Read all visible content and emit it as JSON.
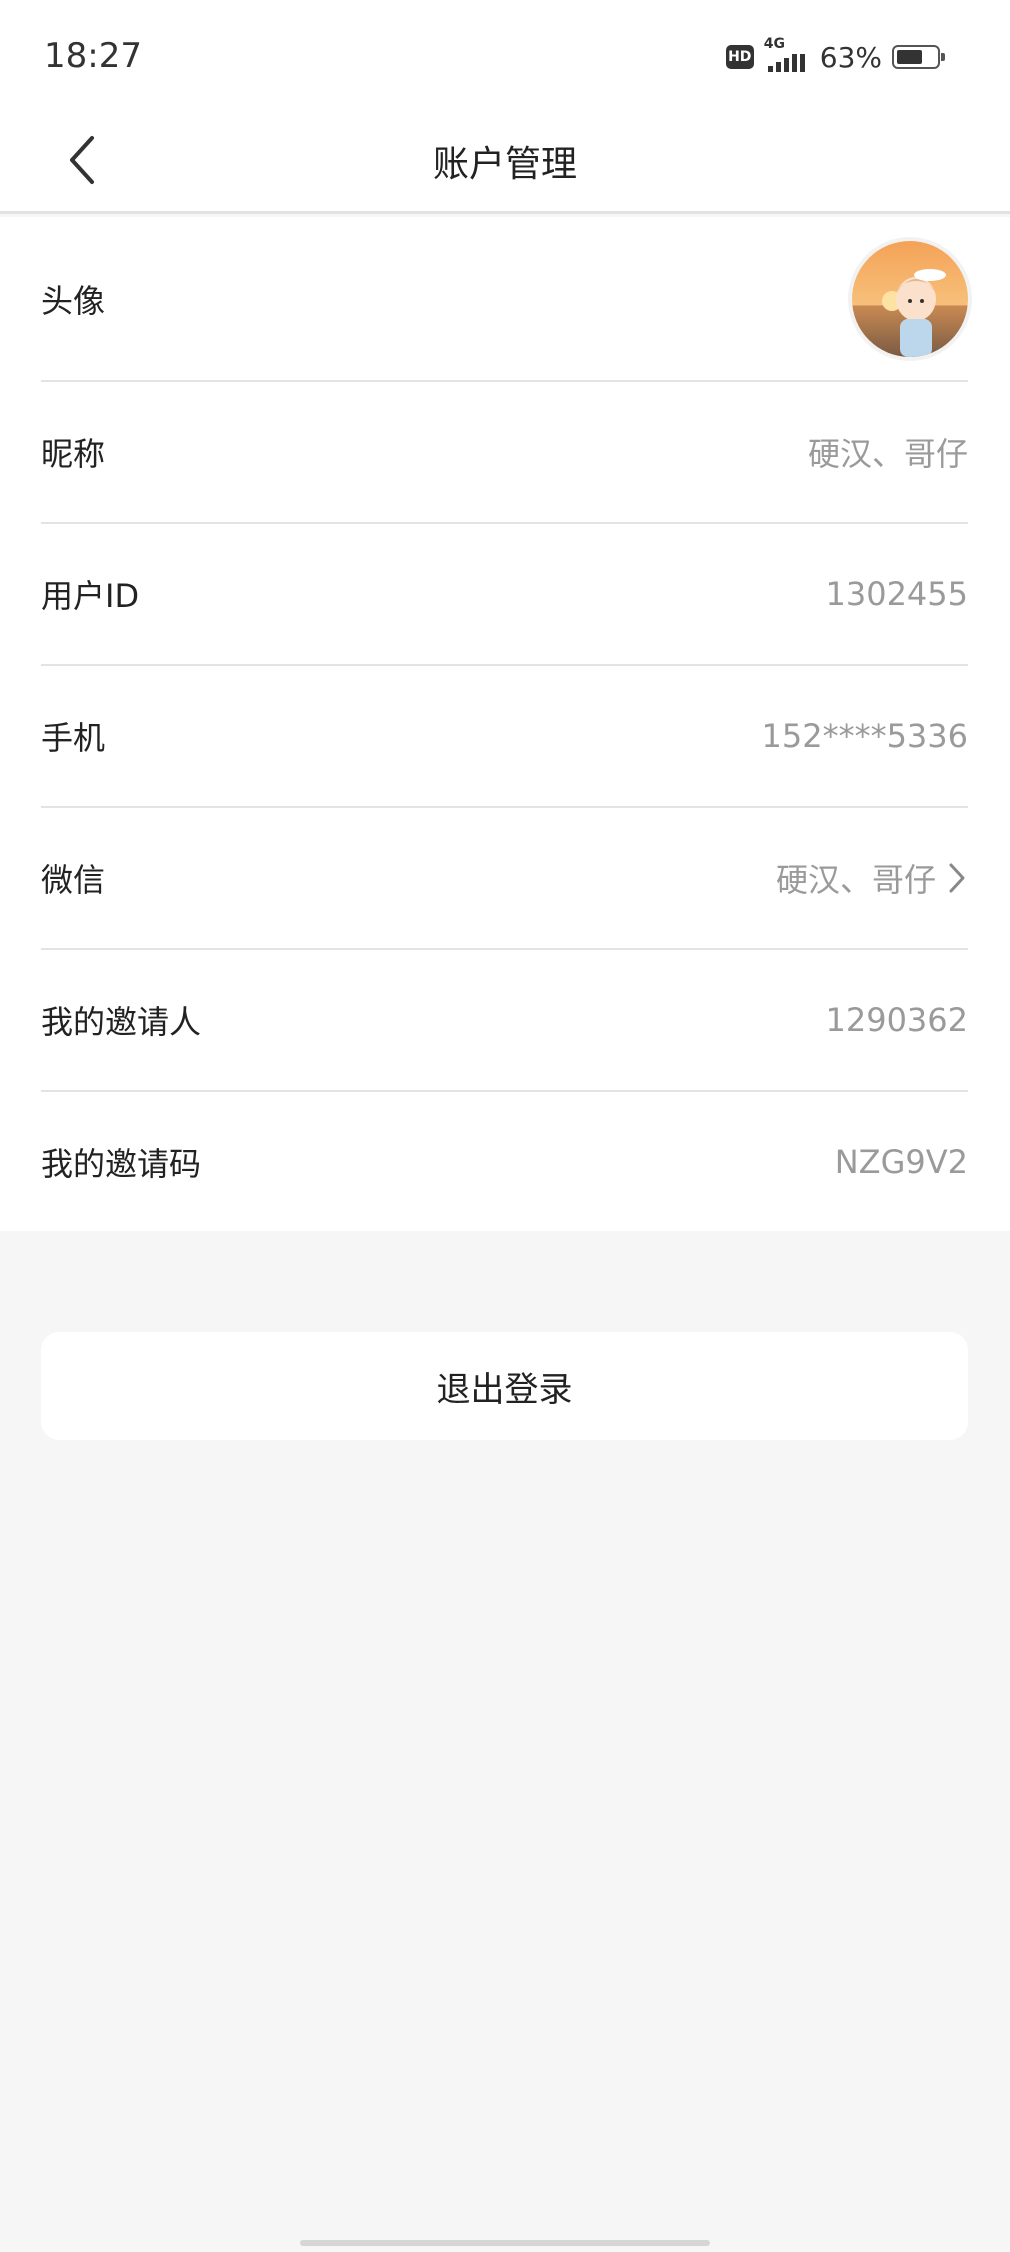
{
  "status_bar": {
    "time": "18:27",
    "hd": "HD",
    "network": "4G",
    "battery": "63%",
    "battery_level": 0.63
  },
  "header": {
    "title": "账户管理",
    "back_icon": "chevron-left-icon"
  },
  "account": {
    "rows": [
      {
        "label": "头像",
        "type": "avatar"
      },
      {
        "label": "昵称",
        "value": "硬汉、哥仔"
      },
      {
        "label": "用户ID",
        "value": "1302455"
      },
      {
        "label": "手机",
        "value": "152****5336"
      },
      {
        "label": "微信",
        "value": "硬汉、哥仔",
        "has_arrow": true
      },
      {
        "label": "我的邀请人",
        "value": "1290362"
      },
      {
        "label": "我的邀请码",
        "value": "NZG9V2"
      }
    ]
  },
  "logout": {
    "label": "退出登录"
  },
  "colors": {
    "background": "#f6f6f6",
    "card": "#ffffff",
    "value_text": "#9a9a9a",
    "divider": "#e3e3e3"
  }
}
